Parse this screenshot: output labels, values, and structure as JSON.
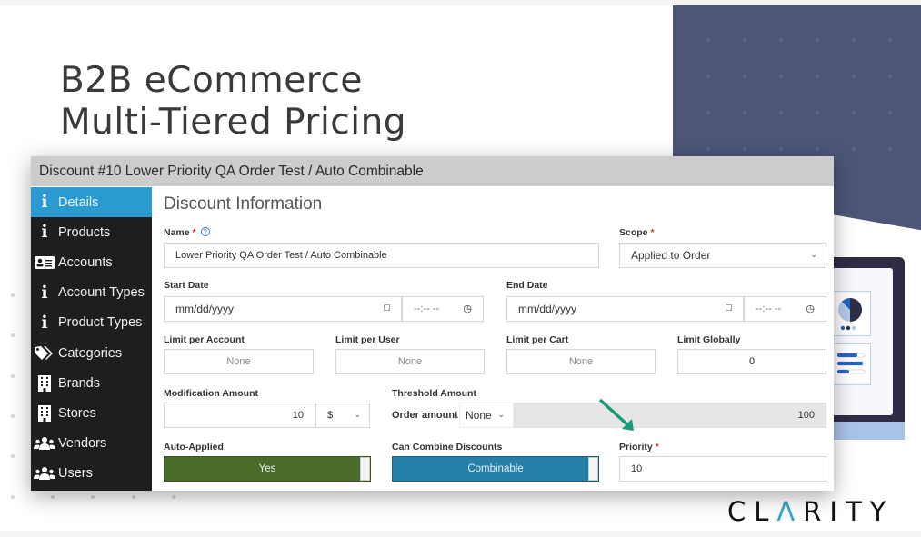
{
  "slide": {
    "title_line1": "B2B eCommerce",
    "title_line2": "Multi-Tiered Pricing",
    "brand": {
      "pre": "CL",
      "drop": "Λ",
      "post": "RITY"
    },
    "accent_colors": {
      "panel": "#4d5676",
      "brand_drop": "#2aa7d8",
      "arrow": "#1a9a76"
    }
  },
  "window": {
    "header": "Discount #10 Lower Priority QA Order Test / Auto Combinable"
  },
  "sidebar": {
    "items": [
      {
        "label": "Details",
        "icon": "info-icon",
        "active": true
      },
      {
        "label": "Products",
        "icon": "info-icon"
      },
      {
        "label": "Accounts",
        "icon": "id-card-icon"
      },
      {
        "label": "Account Types",
        "icon": "info-icon"
      },
      {
        "label": "Product Types",
        "icon": "info-icon"
      },
      {
        "label": "Categories",
        "icon": "tags-icon"
      },
      {
        "label": "Brands",
        "icon": "building-icon"
      },
      {
        "label": "Stores",
        "icon": "building-icon"
      },
      {
        "label": "Vendors",
        "icon": "users-icon"
      },
      {
        "label": "Users",
        "icon": "users-icon"
      }
    ]
  },
  "form": {
    "section_title": "Discount Information",
    "name": {
      "label": "Name",
      "required": "*",
      "help": "?",
      "value": "Lower Priority QA Order Test / Auto Combinable"
    },
    "scope": {
      "label": "Scope",
      "required": "*",
      "value": "Applied to Order"
    },
    "start_date": {
      "label": "Start Date",
      "date_placeholder": "mm/dd/yyyy",
      "time_placeholder": "--:-- --"
    },
    "end_date": {
      "label": "End Date",
      "date_placeholder": "mm/dd/yyyy",
      "time_placeholder": "--:-- --"
    },
    "limit_per_account": {
      "label": "Limit per Account",
      "value": "None"
    },
    "limit_per_user": {
      "label": "Limit per User",
      "value": "None"
    },
    "limit_per_cart": {
      "label": "Limit per Cart",
      "value": "None"
    },
    "limit_globally": {
      "label": "Limit Globally",
      "value": "0"
    },
    "modification_amount": {
      "label": "Modification Amount",
      "value": "10",
      "unit": "$"
    },
    "threshold_amount": {
      "label": "Threshold Amount",
      "sub_label": "Order amount",
      "mode": "None",
      "value": "100"
    },
    "auto_applied": {
      "label": "Auto-Applied",
      "value": "Yes",
      "color": "#4a6b2a"
    },
    "can_combine": {
      "label": "Can Combine Discounts",
      "value": "Combinable",
      "color": "#2480a7"
    },
    "priority": {
      "label": "Priority",
      "required": "*",
      "value": "10"
    }
  }
}
